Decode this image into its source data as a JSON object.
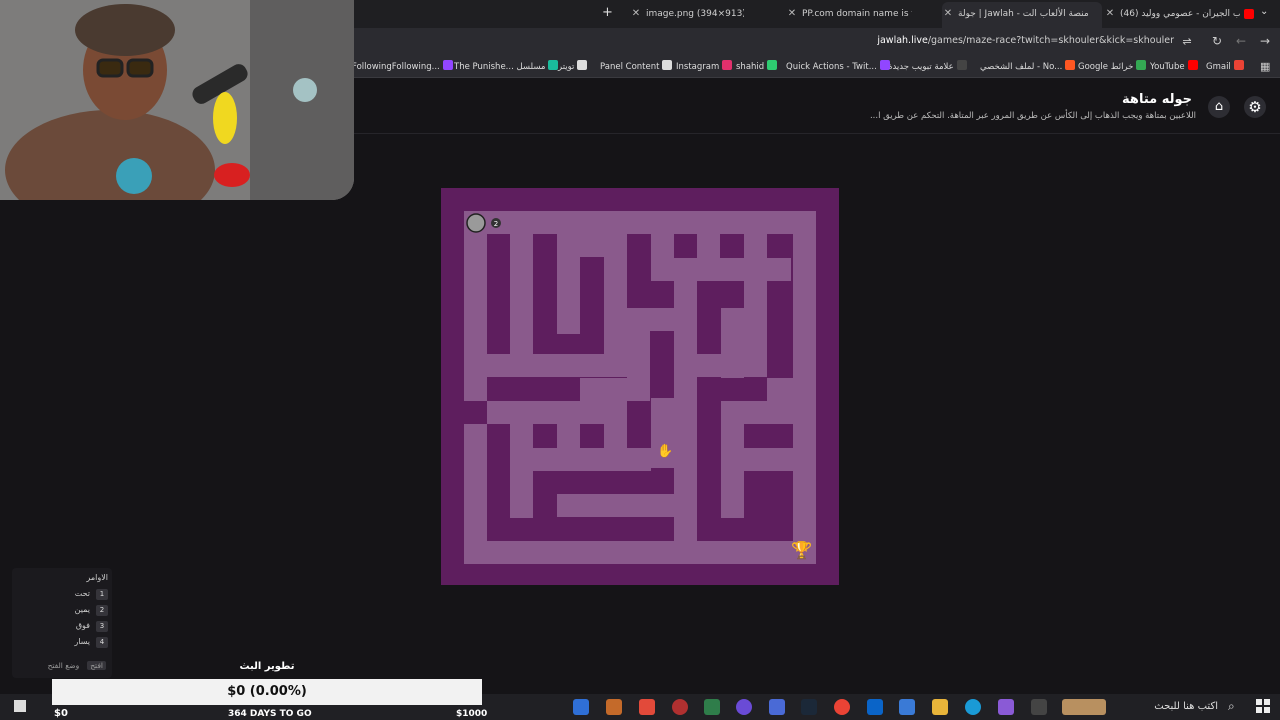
{
  "browser": {
    "tabs": [
      {
        "title": "image.png (394×913)",
        "active": false,
        "fav_color": "#e8e8e8"
      },
      {
        "title": "PP.com domain name is for sale",
        "active": false,
        "fav_color": "#5865f2"
      },
      {
        "title": "جولة | Jawlah - منصة الألعاب الت",
        "active": true,
        "fav_color": "#cccccc"
      },
      {
        "title": "(46) ألعاب الجيران - عصومي ووليد",
        "active": false,
        "fav_color": "#ff0000"
      }
    ],
    "url": {
      "host": "jawlah.live",
      "path": "/games/maze-race?twitch=skhouler&kick=skhouler"
    },
    "bookmarks": [
      {
        "label": "Gmail",
        "color": "#ea4335"
      },
      {
        "label": "YouTube",
        "color": "#ff0000"
      },
      {
        "label": "Google خرائط",
        "color": "#34a853"
      },
      {
        "label": "لملف الشخصي - No...",
        "color": "#ff5722"
      },
      {
        "label": "علامة تبويب جديدة",
        "color": "#444444"
      },
      {
        "label": "Quick Actions - Twit...",
        "color": "#9146ff"
      },
      {
        "label": "shahid",
        "color": "#2ecc71"
      },
      {
        "label": "Instagram",
        "color": "#e1306c"
      },
      {
        "label": "Panel Content",
        "color": "#dddddd"
      },
      {
        "label": "تويتر",
        "color": "#dddddd"
      },
      {
        "label": "The Punishe... مسلسل",
        "color": "#1abc9c"
      },
      {
        "label": "FollowingFollowing...",
        "color": "#9146ff"
      }
    ]
  },
  "page": {
    "title": "جوله متاهة",
    "description": "اللاعبين بمتاهة ويجب الذهاب إلى الكأس عن طريق المرور عبر المتاهة. التحكم عن طريق ا...",
    "player_badge": "2",
    "colors": {
      "wall": "#5e1e5e",
      "path": "#8a5a8c",
      "bg": "#151417"
    }
  },
  "commands": {
    "title": "الاوامر",
    "items": [
      {
        "num": "1",
        "label": "تحت"
      },
      {
        "num": "2",
        "label": "يمين"
      },
      {
        "num": "3",
        "label": "فوق"
      },
      {
        "num": "4",
        "label": "يسار"
      }
    ],
    "footer_key": "افتح",
    "footer_label": "وضع الفتح"
  },
  "stream_widget": {
    "title": "تطوير البث",
    "progress_text": "$0 (0.00%)",
    "progress": 0,
    "days_text": "364 DAYS TO GO",
    "goal_text": "$1000",
    "current_text": "$0"
  },
  "taskbar": {
    "search_placeholder": "اكتب هنا للبحث"
  }
}
